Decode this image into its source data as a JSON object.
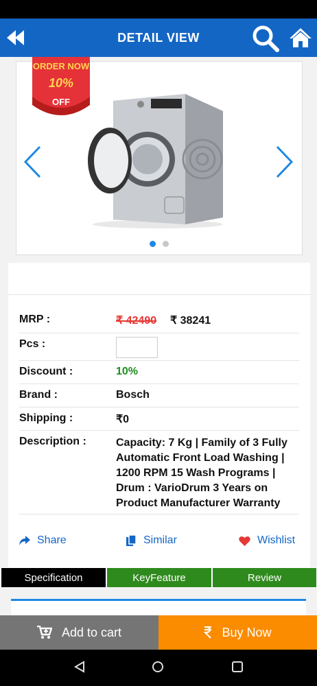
{
  "header": {
    "title": "DETAIL VIEW"
  },
  "badge": {
    "line1": "ORDER NOW",
    "line2": "10%",
    "line3": "OFF"
  },
  "carousel": {
    "dots": 2,
    "active": 0
  },
  "details": {
    "mrp_label": "MRP :",
    "mrp_old": "₹ 42490",
    "mrp_new": "₹ 38241",
    "pcs_label": "Pcs :",
    "pcs_value": "",
    "discount_label": "Discount :",
    "discount_value": "10%",
    "brand_label": "Brand :",
    "brand_value": "Bosch",
    "shipping_label": "Shipping :",
    "shipping_value": "₹0",
    "description_label": "Description :",
    "description_value": "Capacity: 7 Kg | Family of 3 Fully Automatic Front Load Washing | 1200 RPM 15 Wash Programs | Drum : VarioDrum 3 Years on Product Manufacturer Warranty"
  },
  "actions": {
    "share": "Share",
    "similar": "Similar",
    "wishlist": "Wishlist"
  },
  "tabs": [
    "Specification",
    "KeyFeature",
    "Review"
  ],
  "bottom": {
    "add_to_cart": "Add to cart",
    "buy_now": "Buy Now"
  },
  "colors": {
    "primary": "#1466c4",
    "discount": "#1e8e1e",
    "mrp_strike": "#e53935",
    "tab_green": "#2f8a1e",
    "buy": "#fb8c00",
    "cart": "#757575"
  }
}
